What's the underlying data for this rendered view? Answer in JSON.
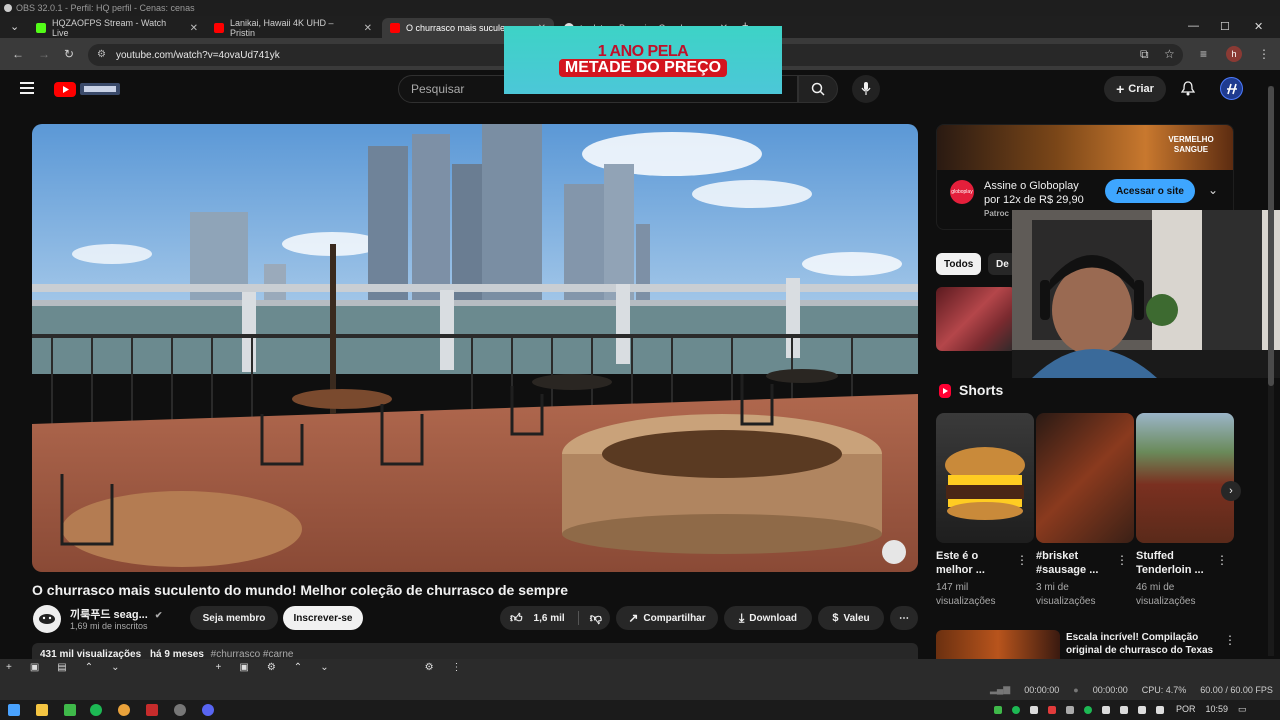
{
  "obs": {
    "title": "OBS 32.0.1 - Perfil: HQ perfil - Cenas: cenas",
    "status": {
      "time1": "00:00:00",
      "time2": "00:00:00",
      "cpu": "CPU: 4.7%",
      "fps": "60.00 / 60.00 FPS"
    }
  },
  "browser": {
    "tabs": [
      {
        "title": "HQZAOFPS Stream - Watch Live",
        "color": "#53fc18"
      },
      {
        "title": "Lanikai, Hawaii 4K UHD – Pristin",
        "color": "#ff0000"
      },
      {
        "title": "O churrasco mais suculen",
        "color": "#ff0000"
      },
      {
        "title": "tradutor - Pesquisa Google",
        "color": "#cccccc"
      }
    ],
    "url": "youtube.com/watch?v=4ovaUd741yk",
    "profile_initial": "h"
  },
  "youtube": {
    "search_placeholder": "Pesquisar",
    "create_label": "Criar"
  },
  "promo": {
    "line1": "1 ANO PELA",
    "line2": "METADE DO PREÇO"
  },
  "video": {
    "title": "O churrasco mais suculento do mundo! Melhor coleção de churrasco de sempre",
    "channel_name": "끼룩푸드 seag...",
    "subscribers": "1,69 mi de inscritos",
    "member_label": "Seja membro",
    "subscribe_label": "Inscrever-se",
    "likes": "1,6 mil",
    "share_label": "Compartilhar",
    "download_label": "Download",
    "thanks_label": "Valeu",
    "views": "431 mil visualizações",
    "age": "há 9 meses",
    "tags": "#churrasco #carne"
  },
  "sidebar": {
    "ad": {
      "image_title": "VERMELHO SANGUE",
      "text_line1": "Assine o Globoplay",
      "text_line2": "por 12x de R$ 29,90",
      "sponsor": "Patroc",
      "cta": "Acessar o site",
      "logo_text": "globoplay"
    },
    "chips": [
      "Todos",
      "De"
    ],
    "shorts_heading": "Shorts",
    "shorts": [
      {
        "title_line1": "Este é o",
        "title_line2": "melhor ...",
        "views_line1": "147 mil",
        "views_line2": "visualizações"
      },
      {
        "title_line1": "#brisket",
        "title_line2": "#sausage ...",
        "views_line1": "3 mi de",
        "views_line2": "visualizações"
      },
      {
        "title_line1": "Stuffed",
        "title_line2": "Tenderloin ...",
        "views_line1": "46 mi de",
        "views_line2": "visualizações"
      }
    ],
    "next_video": {
      "title_line1": "Escala incrível! Compilação",
      "title_line2": "original de churrasco do Texas"
    }
  },
  "taskbar": {
    "lang": "POR",
    "clock": "10:59"
  }
}
